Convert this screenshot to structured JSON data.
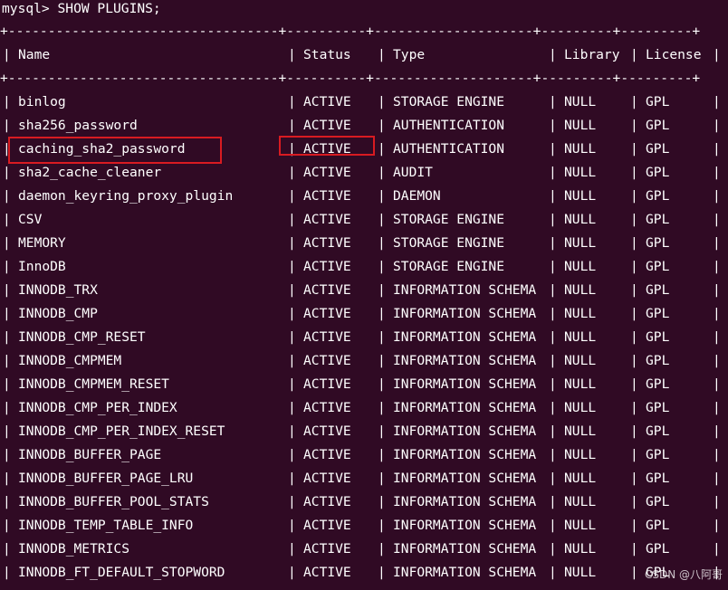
{
  "prompt": "mysql> SHOW PLUGINS;",
  "separator": "+----------------------------------+----------+--------------------+---------+---------+",
  "columns": [
    "Name",
    "Status",
    "Type",
    "Library",
    "License"
  ],
  "rows": [
    [
      "binlog",
      "ACTIVE",
      "STORAGE ENGINE",
      "NULL",
      "GPL"
    ],
    [
      "sha256_password",
      "ACTIVE",
      "AUTHENTICATION",
      "NULL",
      "GPL"
    ],
    [
      "caching_sha2_password",
      "ACTIVE",
      "AUTHENTICATION",
      "NULL",
      "GPL"
    ],
    [
      "sha2_cache_cleaner",
      "ACTIVE",
      "AUDIT",
      "NULL",
      "GPL"
    ],
    [
      "daemon_keyring_proxy_plugin",
      "ACTIVE",
      "DAEMON",
      "NULL",
      "GPL"
    ],
    [
      "CSV",
      "ACTIVE",
      "STORAGE ENGINE",
      "NULL",
      "GPL"
    ],
    [
      "MEMORY",
      "ACTIVE",
      "STORAGE ENGINE",
      "NULL",
      "GPL"
    ],
    [
      "InnoDB",
      "ACTIVE",
      "STORAGE ENGINE",
      "NULL",
      "GPL"
    ],
    [
      "INNODB_TRX",
      "ACTIVE",
      "INFORMATION SCHEMA",
      "NULL",
      "GPL"
    ],
    [
      "INNODB_CMP",
      "ACTIVE",
      "INFORMATION SCHEMA",
      "NULL",
      "GPL"
    ],
    [
      "INNODB_CMP_RESET",
      "ACTIVE",
      "INFORMATION SCHEMA",
      "NULL",
      "GPL"
    ],
    [
      "INNODB_CMPMEM",
      "ACTIVE",
      "INFORMATION SCHEMA",
      "NULL",
      "GPL"
    ],
    [
      "INNODB_CMPMEM_RESET",
      "ACTIVE",
      "INFORMATION SCHEMA",
      "NULL",
      "GPL"
    ],
    [
      "INNODB_CMP_PER_INDEX",
      "ACTIVE",
      "INFORMATION SCHEMA",
      "NULL",
      "GPL"
    ],
    [
      "INNODB_CMP_PER_INDEX_RESET",
      "ACTIVE",
      "INFORMATION SCHEMA",
      "NULL",
      "GPL"
    ],
    [
      "INNODB_BUFFER_PAGE",
      "ACTIVE",
      "INFORMATION SCHEMA",
      "NULL",
      "GPL"
    ],
    [
      "INNODB_BUFFER_PAGE_LRU",
      "ACTIVE",
      "INFORMATION SCHEMA",
      "NULL",
      "GPL"
    ],
    [
      "INNODB_BUFFER_POOL_STATS",
      "ACTIVE",
      "INFORMATION SCHEMA",
      "NULL",
      "GPL"
    ],
    [
      "INNODB_TEMP_TABLE_INFO",
      "ACTIVE",
      "INFORMATION SCHEMA",
      "NULL",
      "GPL"
    ],
    [
      "INNODB_METRICS",
      "ACTIVE",
      "INFORMATION SCHEMA",
      "NULL",
      "GPL"
    ],
    [
      "INNODB_FT_DEFAULT_STOPWORD",
      "ACTIVE",
      "INFORMATION SCHEMA",
      "NULL",
      "GPL"
    ]
  ],
  "highlighted_row_index": 2,
  "colors": {
    "background": "#300a24",
    "text": "#ffffff",
    "highlight_box": "#d81b21"
  },
  "watermark": "CSDN @八阿哥"
}
